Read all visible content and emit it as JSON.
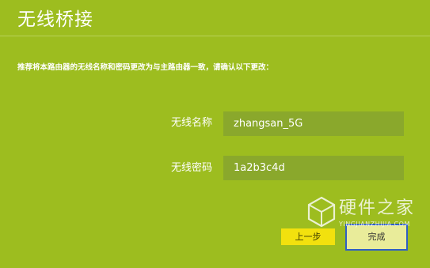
{
  "page": {
    "title": "无线桥接",
    "instruction": "推荐将本路由器的无线名称和密码更改为与主路由器一致，请确认以下更改："
  },
  "form": {
    "ssid_label": "无线名称",
    "ssid_value": "zhangsan_5G",
    "password_label": "无线密码",
    "password_value": "1a2b3c4d"
  },
  "buttons": {
    "prev_label": "上一步",
    "finish_label": "完成"
  },
  "watermark": {
    "brand": "硬件之家",
    "url": "YINGJIANZHIJIA.COM"
  },
  "colors": {
    "background": "#9dbd1f",
    "input_bg": "#8aa82c",
    "prev_button": "#f2e10e",
    "focus_border": "#2f5fc5"
  }
}
